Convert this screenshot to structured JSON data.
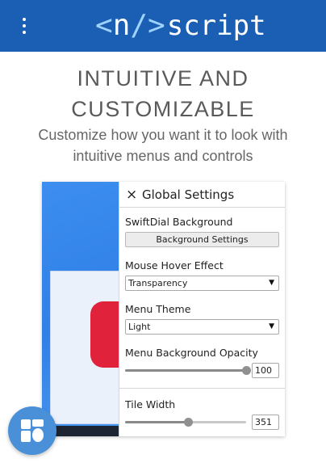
{
  "header": {
    "logo_open": "<",
    "logo_n": "n",
    "logo_slash": "/>",
    "logo_word": "script",
    "menu_icon": "more-vert-icon"
  },
  "hero": {
    "title": "INTUITIVE AND CUSTOMIZABLE",
    "subtitle": "Customize how you want it to look with intuitive menus and controls"
  },
  "settings_panel": {
    "close_icon": "close-icon",
    "close_glyph": "×",
    "title": "Global Settings",
    "swiftdial_label": "SwiftDial Background",
    "background_button_label": "Background Settings",
    "hover_label": "Mouse Hover Effect",
    "hover_value": "Transparency",
    "theme_label": "Menu Theme",
    "theme_value": "Light",
    "opacity_label": "Menu Background Opacity",
    "opacity_value": "100",
    "opacity_fraction": 1.0,
    "tile_width_label": "Tile Width",
    "tile_width_value": "351",
    "tile_width_fraction": 0.52
  },
  "fab": {
    "icon": "apps-grid-icon"
  },
  "colors": {
    "header_bg": "#1a5fb4",
    "logo_bracket": "#9fd3ff",
    "fab_bg": "#4a90d9",
    "desktop_blue": "#2f7fe6",
    "accent_red": "#e0233a"
  }
}
